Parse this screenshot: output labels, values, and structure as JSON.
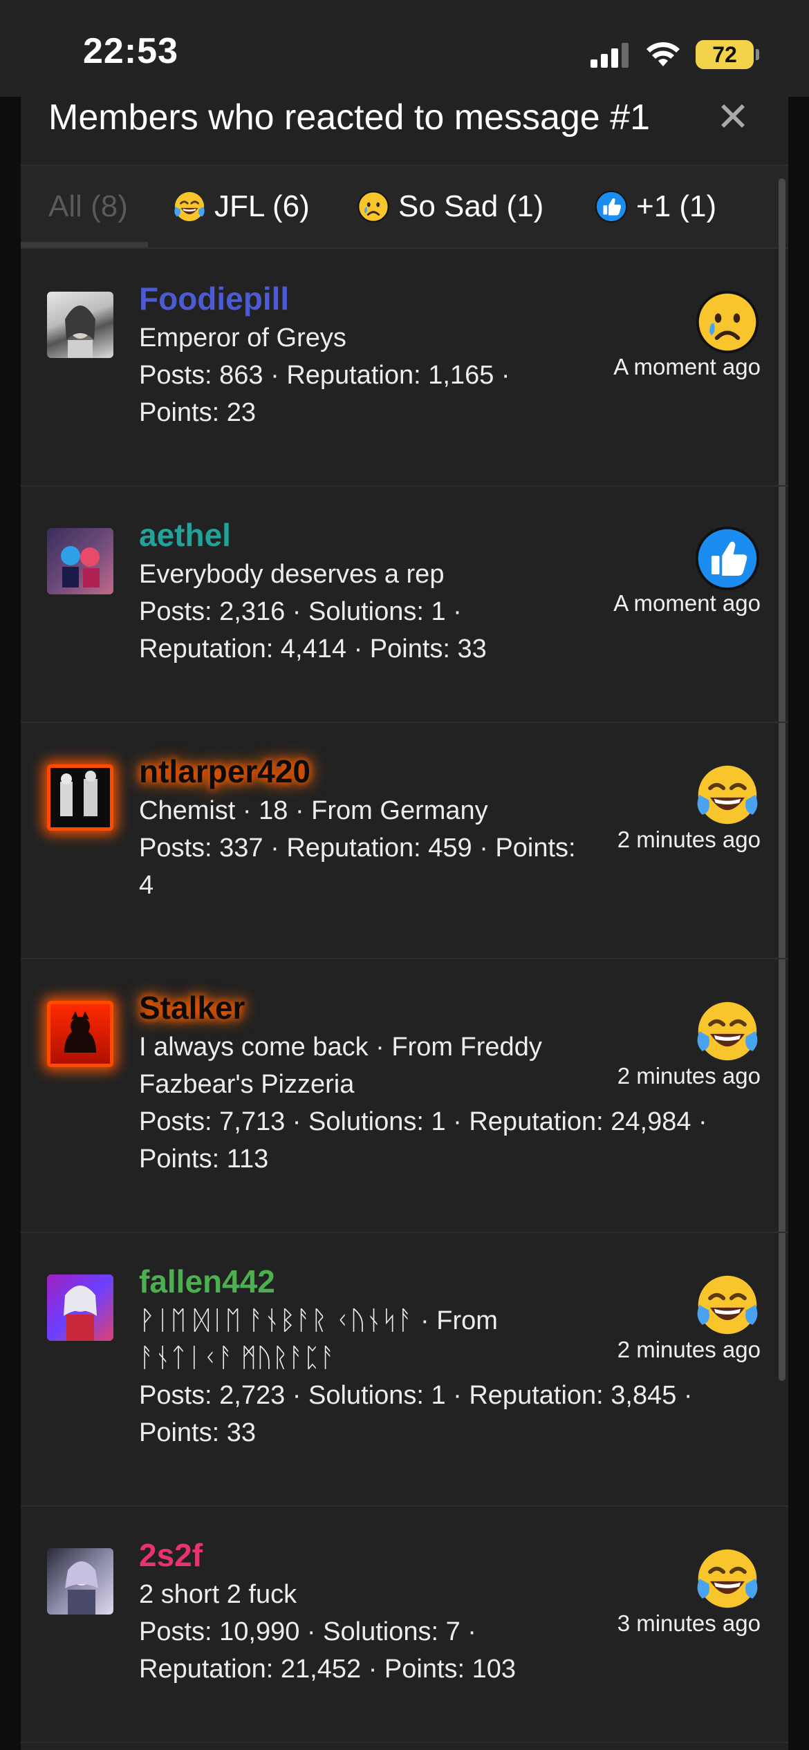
{
  "status_bar": {
    "time": "22:53",
    "battery": "72",
    "icons": [
      "signal-icon",
      "wifi-icon",
      "battery-icon"
    ]
  },
  "modal": {
    "title": "Members who reacted to message #1",
    "close_icon": "close-icon"
  },
  "tabs": [
    {
      "label": "All (8)",
      "icon": ""
    },
    {
      "label": "JFL (6)",
      "icon": "laughing-crying-emoji-icon"
    },
    {
      "label": "So Sad (1)",
      "icon": "sad-emoji-icon"
    },
    {
      "label": "+1 (1)",
      "icon": "thumbs-up-icon"
    }
  ],
  "colors": {
    "blue_user": "#4c5bd4",
    "teal_user": "#1fa39a",
    "green_user": "#4caf50",
    "pink_user": "#e8336f",
    "glow_orange": "#ff5a00"
  },
  "members": [
    {
      "username": "Foodiepill",
      "title": "Emperor of Greys",
      "stats_1": "Posts: 863 · Reputation: 1,165 ·",
      "stats_2": "Points: 23",
      "reaction": "sad-emoji-icon",
      "time": "A moment ago"
    },
    {
      "username": "aethel",
      "title": "Everybody deserves a rep",
      "stats_1": "Posts: 2,316 · Solutions: 1 ·",
      "stats_2": "Reputation: 4,414 · Points: 33",
      "reaction": "thumbs-up-icon",
      "time": "A moment ago"
    },
    {
      "username": "ntlarper420",
      "title": "Chemist · 18 · From Germany",
      "stats_1": "Posts: 337 · Reputation: 459 · Points:",
      "stats_2": "4",
      "reaction": "laughing-crying-emoji-icon",
      "time": "2 minutes ago"
    },
    {
      "username": "Stalker",
      "title_1": "I always come back · From Freddy",
      "title_2": "Fazbear's Pizzeria",
      "stats_1": "Posts: 7,713 · Solutions: 1 · Reputation: 24,984 ·",
      "stats_2": "Points: 113",
      "reaction": "laughing-crying-emoji-icon",
      "time": "2 minutes ago"
    },
    {
      "username": "fallen442",
      "title_1": "ᚹᛁᛖ ᛞᛁᛖ ᚨᚾᛒᚨᚱ ᚲᚢᚾᛋᚨ · From",
      "title_2": "ᚨᚾᛏᛁᚲᚨ ᛗᚢᚱᚨᛈᚨ",
      "stats_1": "Posts: 2,723 · Solutions: 1 · Reputation: 3,845 ·",
      "stats_2": "Points: 33",
      "reaction": "laughing-crying-emoji-icon",
      "time": "2 minutes ago"
    },
    {
      "username": "2s2f",
      "title": "2 short 2 fuck",
      "stats_1": "Posts: 10,990 · Solutions: 7 ·",
      "stats_2": "Reputation: 21,452 · Points: 103",
      "reaction": "laughing-crying-emoji-icon",
      "time": "3 minutes ago"
    }
  ]
}
